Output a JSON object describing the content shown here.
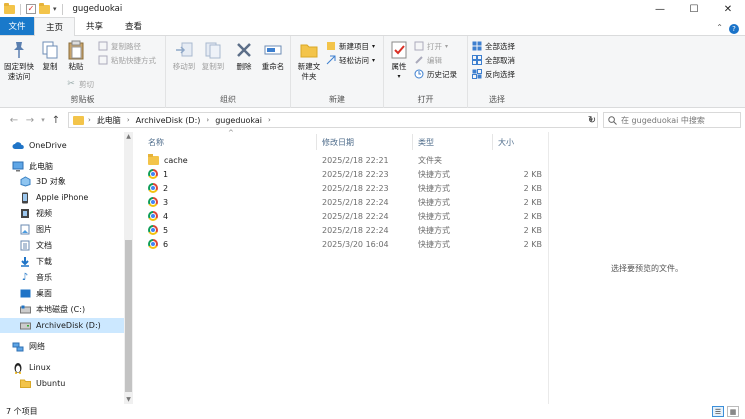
{
  "titlebar": {
    "title": "gugeduokai",
    "minimize": "—",
    "maximize": "☐",
    "close": "✕"
  },
  "tabs": [
    {
      "label": "文件"
    },
    {
      "label": "主页"
    },
    {
      "label": "共享"
    },
    {
      "label": "查看"
    }
  ],
  "ribbon": {
    "clipboard": {
      "label": "剪贴板",
      "pin": "固定到快速访问",
      "copy": "复制",
      "paste": "粘贴",
      "copy_path": "复制路径",
      "paste_shortcut": "粘贴快捷方式",
      "cut": "剪切"
    },
    "organize": {
      "label": "组织",
      "move_to": "移动到",
      "copy_to": "复制到",
      "delete": "删除",
      "rename": "重命名"
    },
    "new": {
      "label": "新建",
      "new_folder": "新建文件夹",
      "new_item": "新建项目",
      "easy_access": "轻松访问"
    },
    "open": {
      "label": "打开",
      "properties": "属性",
      "open": "打开",
      "edit": "编辑",
      "history": "历史记录"
    },
    "select": {
      "label": "选择",
      "select_all": "全部选择",
      "select_none": "全部取消",
      "invert": "反向选择"
    }
  },
  "address": {
    "crumbs": [
      "此电脑",
      "ArchiveDisk (D:)",
      "gugeduokai"
    ],
    "search_placeholder": "在 gugeduokai 中搜索"
  },
  "navpane": {
    "items": [
      {
        "label": "OneDrive",
        "icon": "cloud-icon",
        "indent": 0
      },
      {
        "label": "此电脑",
        "icon": "computer-icon",
        "indent": 0
      },
      {
        "label": "3D 对象",
        "icon": "cube-icon",
        "indent": 1
      },
      {
        "label": "Apple iPhone",
        "icon": "phone-icon",
        "indent": 1
      },
      {
        "label": "视频",
        "icon": "video-icon",
        "indent": 1
      },
      {
        "label": "图片",
        "icon": "picture-icon",
        "indent": 1
      },
      {
        "label": "文档",
        "icon": "document-icon",
        "indent": 1
      },
      {
        "label": "下载",
        "icon": "download-icon",
        "indent": 1
      },
      {
        "label": "音乐",
        "icon": "music-icon",
        "indent": 1
      },
      {
        "label": "桌面",
        "icon": "desktop-icon",
        "indent": 1
      },
      {
        "label": "本地磁盘 (C:)",
        "icon": "drive-icon",
        "indent": 1
      },
      {
        "label": "ArchiveDisk (D:)",
        "icon": "drive-icon",
        "indent": 1,
        "selected": true
      },
      {
        "label": "网络",
        "icon": "network-icon",
        "indent": 0
      },
      {
        "label": "Linux",
        "icon": "linux-icon",
        "indent": 0
      },
      {
        "label": "Ubuntu",
        "icon": "folder-icon",
        "indent": 1
      }
    ]
  },
  "filelist": {
    "headers": {
      "name": "名称",
      "date": "修改日期",
      "type": "类型",
      "size": "大小"
    },
    "rows": [
      {
        "name": "cache",
        "date": "2025/2/18 22:21",
        "type": "文件夹",
        "size": "",
        "icon": "folder-icon"
      },
      {
        "name": "1",
        "date": "2025/2/18 22:23",
        "type": "快捷方式",
        "size": "2 KB",
        "icon": "chrome-icon"
      },
      {
        "name": "2",
        "date": "2025/2/18 22:23",
        "type": "快捷方式",
        "size": "2 KB",
        "icon": "chrome-icon"
      },
      {
        "name": "3",
        "date": "2025/2/18 22:24",
        "type": "快捷方式",
        "size": "2 KB",
        "icon": "chrome-icon"
      },
      {
        "name": "4",
        "date": "2025/2/18 22:24",
        "type": "快捷方式",
        "size": "2 KB",
        "icon": "chrome-icon"
      },
      {
        "name": "5",
        "date": "2025/2/18 22:24",
        "type": "快捷方式",
        "size": "2 KB",
        "icon": "chrome-icon"
      },
      {
        "name": "6",
        "date": "2025/3/20 16:04",
        "type": "快捷方式",
        "size": "2 KB",
        "icon": "chrome-icon"
      }
    ]
  },
  "preview": {
    "text": "选择要预览的文件。"
  },
  "status": {
    "count": "7 个项目"
  }
}
